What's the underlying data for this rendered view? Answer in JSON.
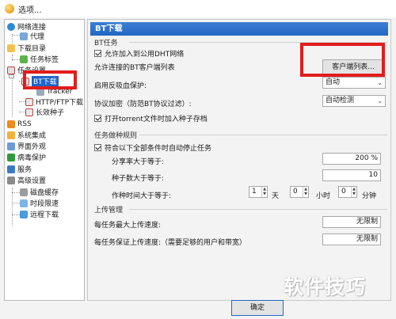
{
  "window": {
    "title": "选项..."
  },
  "sidebar": {
    "items": [
      {
        "label": "网络连接",
        "icon": "globe-network-icon",
        "selected": false
      },
      {
        "label": "代理",
        "icon": "proxy-icon",
        "selected": false
      },
      {
        "label": "下载目录",
        "icon": "folder-icon",
        "selected": false
      },
      {
        "label": "任务标签",
        "icon": "tag-icon",
        "selected": false
      },
      {
        "label": "任务设置",
        "icon": "task-settings-icon",
        "selected": false
      },
      {
        "label": "BT下载",
        "icon": "bt-icon",
        "selected": true
      },
      {
        "label": "Tracker",
        "icon": "tracker-icon",
        "selected": false
      },
      {
        "label": "HTTP/FTP下载",
        "icon": "http-ftp-icon",
        "selected": false
      },
      {
        "label": "长效种子",
        "icon": "seed-icon",
        "selected": false
      },
      {
        "label": "RSS",
        "icon": "rss-icon",
        "selected": false
      },
      {
        "label": "系统集成",
        "icon": "system-integration-icon",
        "selected": false
      },
      {
        "label": "界面外观",
        "icon": "appearance-icon",
        "selected": false
      },
      {
        "label": "病毒保护",
        "icon": "shield-icon",
        "selected": false
      },
      {
        "label": "服务",
        "icon": "service-icon",
        "selected": false
      },
      {
        "label": "高级设置",
        "icon": "advanced-settings-icon",
        "selected": false
      },
      {
        "label": "磁盘缓存",
        "icon": "disk-cache-icon",
        "selected": false
      },
      {
        "label": "时段限速",
        "icon": "schedule-icon",
        "selected": false
      },
      {
        "label": "远程下载",
        "icon": "remote-download-icon",
        "selected": false
      }
    ]
  },
  "panel": {
    "title": "BT下载",
    "bt_task": {
      "group_label": "BT任务",
      "public_dht": {
        "label": "允许加入到公用DHT网络",
        "checked": true
      },
      "allowed_clients_label": "允许连接的BT客户端列表",
      "client_list_button": "客户端列表...",
      "anti_leech_label": "启用反吸血保护:",
      "anti_leech_value": "自动",
      "protocol_encryption_label": "协议加密（防范BT协议过滤）:",
      "protocol_encryption_value": "自动检测",
      "torrent_save": {
        "label": "打开torrent文件时加入种子存档",
        "checked": true
      }
    },
    "seeding_rules": {
      "group_label": "任务做种规则",
      "stop_when_all": {
        "label": "符合以下全部条件时自动停止任务",
        "checked": true
      },
      "share_ratio_label": "分享率大于等于:",
      "share_ratio_value": "200 %",
      "seeds_label": "种子数大于等于:",
      "seeds_value": "10",
      "seed_time_label": "作种时间大于等于:",
      "days_value": "1",
      "days_unit": "天",
      "hours_value": "0",
      "hours_unit": "小时",
      "minutes_value": "0",
      "minutes_unit": "分钟"
    },
    "upload": {
      "group_label": "上传管理",
      "max_upload_label": "每任务最大上传速度:",
      "max_upload_value": "无限制",
      "guaranteed_label": "每任务保证上传速度:（需要足够的用户和带宽）",
      "guaranteed_value": "无限制"
    }
  },
  "footer": {
    "ok_button": "确定"
  },
  "watermark": {
    "text": "软件技巧"
  },
  "colors": {
    "accent": "#2467c2",
    "annotation": "#e31c1c"
  }
}
